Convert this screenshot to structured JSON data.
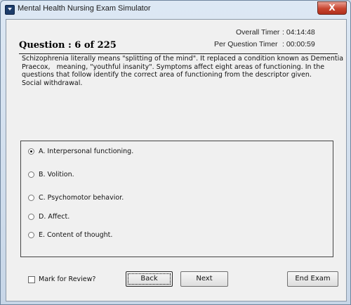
{
  "window": {
    "title": "Mental Health Nursing Exam Simulator",
    "close_glyph": "X"
  },
  "header": {
    "question_label": "Question : 6 of 225",
    "overall_timer_label": "Overall Timer",
    "overall_timer_value": ":  04:14:48",
    "question_timer_label": "Per Question Timer",
    "question_timer_value": ":  00:00:59"
  },
  "question": {
    "lines": [
      "Schizophrenia literally means \"splitting of the mind\". It replaced a condition known as Dementia",
      "Praecox,   meaning, \"youthful insanity\". Symptoms affect eight areas of functioning. In the",
      "questions that follow identify the correct area of functioning from the descriptor given.",
      "Social withdrawal."
    ]
  },
  "options": [
    {
      "label": "A. Interpersonal functioning.",
      "selected": true
    },
    {
      "label": "B. Volition.",
      "selected": false
    },
    {
      "label": "C. Psychomotor behavior.",
      "selected": false
    },
    {
      "label": "D. Affect.",
      "selected": false
    },
    {
      "label": "E. Content of thought.",
      "selected": false
    }
  ],
  "footer": {
    "review_label": "Mark for Review?",
    "review_checked": false,
    "back_label": "Back",
    "next_label": "Next",
    "end_label": "End Exam"
  },
  "colors": {
    "frame": "#c7d6e7",
    "client_bg": "#f0f0f0",
    "close_red": "#c8452f"
  }
}
